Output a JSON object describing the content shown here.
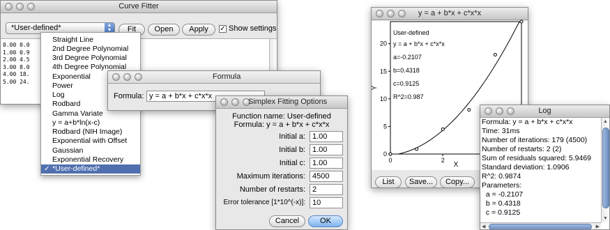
{
  "curve_fitter": {
    "title": "Curve Fitter",
    "selected_fit": "*User-defined*",
    "fit_label": "Fit",
    "open_label": "Open",
    "apply_label": "Apply",
    "show_settings_label": "Show settings",
    "show_settings_checked": true,
    "data_rows": [
      "0.00 0.0",
      "1.00 0.9",
      "2.00 4.5",
      "3.00 8.0",
      "4.00 18.",
      "5.00 24."
    ]
  },
  "fit_menu": {
    "items": [
      "Straight Line",
      "2nd Degree Polynomial",
      "3rd Degree Polynomial",
      "4th Degree Polynomial",
      "Exponential",
      "Power",
      "Log",
      "Rodbard",
      "Gamma Variate",
      "y = a+b*ln(x-c)",
      "Rodbard (NIH Image)",
      "Exponential with Offset",
      "Gaussian",
      "Exponential Recovery",
      "*User-defined*"
    ],
    "check_mark": "✓"
  },
  "formula_dialog": {
    "title": "Formula",
    "label": "Formula:",
    "value": "y = a + b*x + c*x*x"
  },
  "simplex": {
    "title": "Simplex Fitting Options",
    "function_name": "Function name: User-defined",
    "formula_line": "Formula: y = a + b*x + c*x*x",
    "initial_a_label": "Initial a:",
    "initial_a": "1.00",
    "initial_b_label": "Initial b:",
    "initial_b": "1.00",
    "initial_c_label": "Initial c:",
    "initial_c": "1.00",
    "max_iter_label": "Maximum iterations:",
    "max_iter": "4500",
    "restarts_label": "Number of restarts:",
    "restarts": "2",
    "tolerance_label": "Error tolerance [1*10^(-x)]:",
    "tolerance": "10",
    "cancel_label": "Cancel",
    "ok_label": "OK"
  },
  "plot_window": {
    "title": "y = a + b*x + c*x*x",
    "legend": [
      "User-defined",
      "y = a + b*x + c*x*x",
      "a=-0.2107",
      "b=0.4318",
      "c=0.9125",
      "R^2=0.987"
    ],
    "list_label": "List",
    "save_label": "Save...",
    "copy_label": "Copy..."
  },
  "chart_data": {
    "type": "scatter",
    "xlabel": "X",
    "ylabel": "Y",
    "xlim": [
      0,
      5
    ],
    "ylim": [
      0,
      24
    ],
    "x_ticks": [
      0,
      2,
      4
    ],
    "y_ticks": [
      0,
      5,
      10,
      15,
      20
    ],
    "points": [
      [
        0,
        0.0
      ],
      [
        1,
        0.9
      ],
      [
        2,
        4.5
      ],
      [
        3,
        8.0
      ],
      [
        4,
        18.0
      ],
      [
        5,
        24.0
      ]
    ],
    "fit": {
      "a": -0.2107,
      "b": 0.4318,
      "c": 0.9125
    }
  },
  "log": {
    "title": "Log",
    "lines": [
      "Formula: y = a + b*x + c*x*x",
      "Time: 31ms",
      "Number of iterations: 179 (4500)",
      "Number of restarts: 2 (2)",
      "Sum of residuals squared: 5.9469",
      "Standard deviation: 1.0906",
      "R^2: 0.9874",
      "Parameters:",
      "  a = -0.2107",
      "  b = 0.4318",
      "  c = 0.9125"
    ]
  }
}
